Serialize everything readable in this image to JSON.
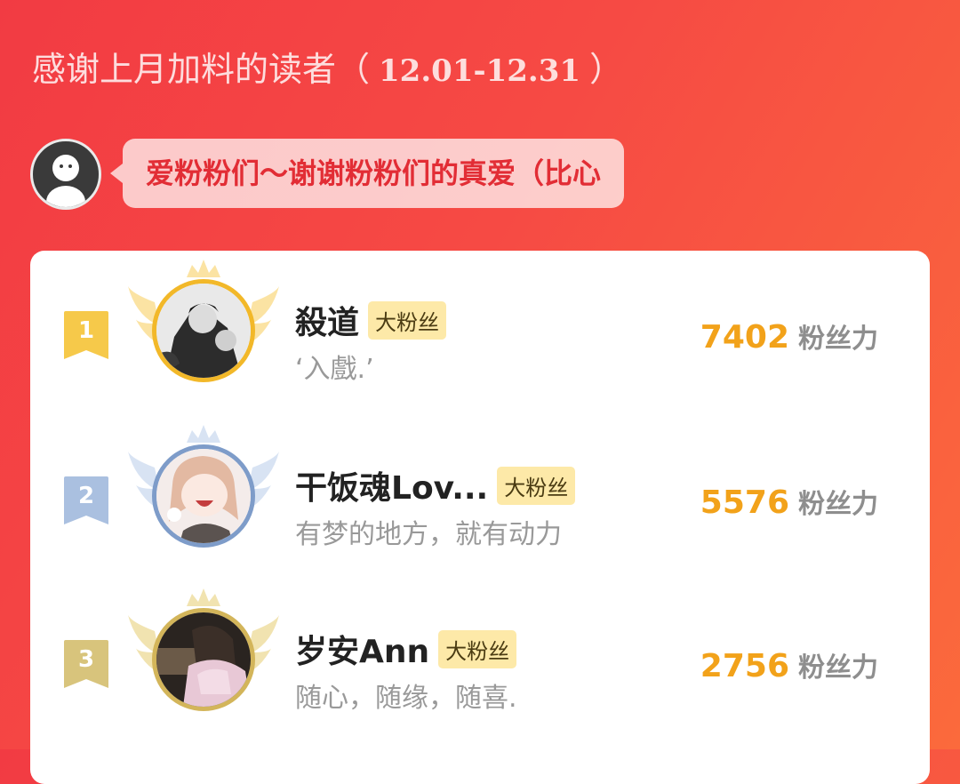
{
  "header": {
    "title_prefix": "感谢上月加料的读者（",
    "date_range": "12.01-12.31",
    "title_suffix": "）"
  },
  "author_message": "爱粉粉们～谢谢粉粉们的真爱（比心",
  "colors": {
    "gold": "#f2b829",
    "silver": "#7e9cc9",
    "bronze": "#d3b55a",
    "score": "#f2a21a",
    "badge_bg": "#fde9a8"
  },
  "fans": [
    {
      "rank": "1",
      "name": "殺道",
      "badge": "大粉丝",
      "signature": "‘入戲.’",
      "score": "7402",
      "unit": "粉丝力"
    },
    {
      "rank": "2",
      "name": "干饭魂Lov...",
      "badge": "大粉丝",
      "signature": "有梦的地方，就有动力",
      "score": "5576",
      "unit": "粉丝力"
    },
    {
      "rank": "3",
      "name": "岁安Ann",
      "badge": "大粉丝",
      "signature": "随心，随缘，随喜.",
      "score": "2756",
      "unit": "粉丝力"
    }
  ]
}
